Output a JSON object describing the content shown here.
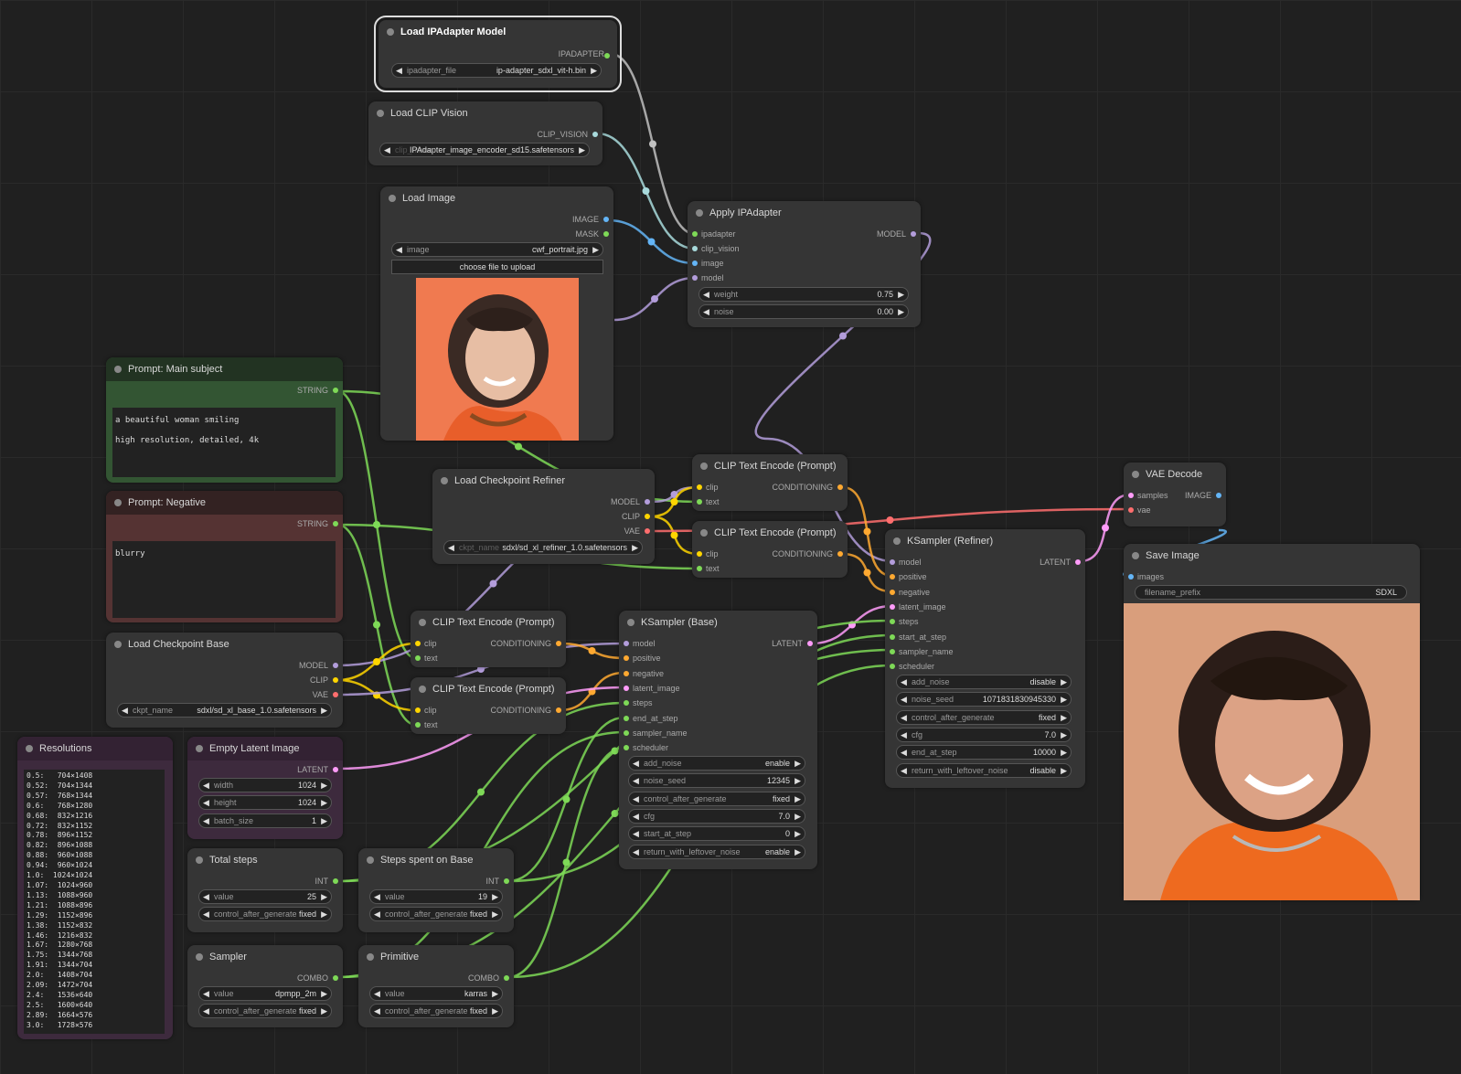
{
  "colors": {
    "model": "#b39ddb",
    "clip": "#ffd500",
    "vae": "#ff6e6e",
    "conditioning": "#ffa931",
    "latent": "#ff9cf9",
    "image": "#64b5f6",
    "string": "#7ed957",
    "int": "#7ed957",
    "ipadapter": "#c0c0c0",
    "clip_vision": "#a8dadc"
  },
  "ipadapter_model": {
    "title": "Load IPAdapter Model",
    "out": "IPADAPTER",
    "w_label": "ipadapter_file",
    "w_value": "ip-adapter_sdxl_vit-h.bin"
  },
  "clip_vision": {
    "title": "Load CLIP Vision",
    "out": "CLIP_VISION",
    "w_label": "clip_name",
    "w_value": "IPAdapter_image_encoder_sd15.safetensors"
  },
  "load_image": {
    "title": "Load Image",
    "out1": "IMAGE",
    "out2": "MASK",
    "w_label": "image",
    "w_value": "cwf_portrait.jpg",
    "upload": "choose file to upload"
  },
  "apply_ipadapter": {
    "title": "Apply IPAdapter",
    "in": [
      "ipadapter",
      "clip_vision",
      "image",
      "model"
    ],
    "out": "MODEL",
    "widgets": [
      {
        "label": "weight",
        "value": "0.75"
      },
      {
        "label": "noise",
        "value": "0.00"
      }
    ]
  },
  "prompt_main": {
    "title": "Prompt: Main subject",
    "out": "STRING",
    "text": "a beautiful woman smiling\nhigh resolution, detailed, 4k"
  },
  "prompt_neg": {
    "title": "Prompt: Negative",
    "out": "STRING",
    "text": "blurry"
  },
  "ckpt_refiner": {
    "title": "Load Checkpoint Refiner",
    "outs": [
      "MODEL",
      "CLIP",
      "VAE"
    ],
    "w_label": "ckpt_name",
    "w_value": "sdxl/sd_xl_refiner_1.0.safetensors"
  },
  "ckpt_base": {
    "title": "Load Checkpoint Base",
    "outs": [
      "MODEL",
      "CLIP",
      "VAE"
    ],
    "w_label": "ckpt_name",
    "w_value": "sdxl/sd_xl_base_1.0.safetensors"
  },
  "clip_encode_label": {
    "title": "CLIP Text Encode (Prompt)",
    "in1": "clip",
    "in2": "text",
    "out": "CONDITIONING"
  },
  "vae_decode": {
    "title": "VAE Decode",
    "in1": "samples",
    "in2": "vae",
    "out": "IMAGE"
  },
  "save_image": {
    "title": "Save Image",
    "in": "images",
    "w_label": "filename_prefix",
    "w_value": "SDXL"
  },
  "ksampler_refiner": {
    "title": "KSampler (Refiner)",
    "in": [
      "model",
      "positive",
      "negative",
      "latent_image",
      "steps",
      "start_at_step",
      "sampler_name",
      "scheduler"
    ],
    "out": "LATENT",
    "widgets": [
      {
        "label": "add_noise",
        "value": "disable"
      },
      {
        "label": "noise_seed",
        "value": "1071831830945330"
      },
      {
        "label": "control_after_generate",
        "value": "fixed"
      },
      {
        "label": "cfg",
        "value": "7.0"
      },
      {
        "label": "end_at_step",
        "value": "10000"
      },
      {
        "label": "return_with_leftover_noise",
        "value": "disable"
      }
    ]
  },
  "ksampler_base": {
    "title": "KSampler (Base)",
    "in": [
      "model",
      "positive",
      "negative",
      "latent_image",
      "steps",
      "end_at_step",
      "sampler_name",
      "scheduler"
    ],
    "out": "LATENT",
    "widgets": [
      {
        "label": "add_noise",
        "value": "enable"
      },
      {
        "label": "noise_seed",
        "value": "12345"
      },
      {
        "label": "control_after_generate",
        "value": "fixed"
      },
      {
        "label": "cfg",
        "value": "7.0"
      },
      {
        "label": "start_at_step",
        "value": "0"
      },
      {
        "label": "return_with_leftover_noise",
        "value": "enable"
      }
    ]
  },
  "resolutions": {
    "title": "Resolutions",
    "lines": [
      "0.5:   704×1408",
      "0.52:  704×1344",
      "0.57:  768×1344",
      "0.6:   768×1280",
      "0.68:  832×1216",
      "0.72:  832×1152",
      "0.78:  896×1152",
      "0.82:  896×1088",
      "0.88:  960×1088",
      "0.94:  960×1024",
      "1.0:  1024×1024",
      "1.07:  1024×960",
      "1.13:  1088×960",
      "1.21:  1088×896",
      "1.29:  1152×896",
      "1.38:  1152×832",
      "1.46:  1216×832",
      "1.67:  1280×768",
      "1.75:  1344×768",
      "1.91:  1344×704",
      "2.0:   1408×704",
      "2.09:  1472×704",
      "2.4:   1536×640",
      "2.5:   1600×640",
      "2.89:  1664×576",
      "3.0:   1728×576"
    ]
  },
  "empty_latent": {
    "title": "Empty Latent Image",
    "out": "LATENT",
    "widgets": [
      {
        "label": "width",
        "value": "1024"
      },
      {
        "label": "height",
        "value": "1024"
      },
      {
        "label": "batch_size",
        "value": "1"
      }
    ]
  },
  "total_steps": {
    "title": "Total steps",
    "out": "INT",
    "widgets": [
      {
        "label": "value",
        "value": "25"
      },
      {
        "label": "control_after_generate",
        "value": "fixed"
      }
    ]
  },
  "steps_base": {
    "title": "Steps spent on Base",
    "out": "INT",
    "widgets": [
      {
        "label": "value",
        "value": "19"
      },
      {
        "label": "control_after_generate",
        "value": "fixed"
      }
    ]
  },
  "sampler": {
    "title": "Sampler",
    "out": "COMBO",
    "widgets": [
      {
        "label": "value",
        "value": "dpmpp_2m"
      },
      {
        "label": "control_after_generate",
        "value": "fixed"
      }
    ]
  },
  "primitive": {
    "title": "Primitive",
    "out": "COMBO",
    "widgets": [
      {
        "label": "value",
        "value": "karras"
      },
      {
        "label": "control_after_generate",
        "value": "fixed"
      }
    ]
  }
}
